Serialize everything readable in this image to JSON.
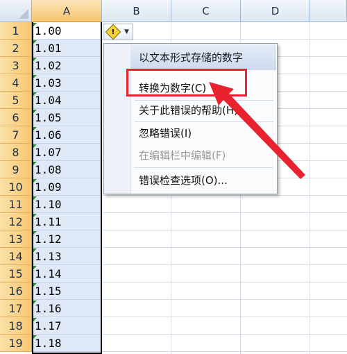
{
  "sheet": {
    "column_headers": [
      "A",
      "B",
      "C",
      "D"
    ],
    "row_numbers": [
      "1",
      "2",
      "3",
      "4",
      "5",
      "6",
      "7",
      "8",
      "9",
      "10",
      "11",
      "12",
      "13",
      "14",
      "15",
      "16",
      "17",
      "18",
      "19"
    ],
    "column_a_values": [
      "1.00",
      "1.01",
      "1.02",
      "1.03",
      "1.04",
      "1.05",
      "1.06",
      "1.07",
      "1.08",
      "1.09",
      "1.10",
      "1.11",
      "1.12",
      "1.13",
      "1.14",
      "1.15",
      "1.16",
      "1.17",
      "1.18"
    ]
  },
  "error_button": {
    "icon": "warning-diamond-icon",
    "symbol": "!",
    "dropdown_icon": "chevron-down-icon"
  },
  "context_menu": {
    "header": "以文本形式存储的数字",
    "items": [
      {
        "label": "转换为数字(C)",
        "enabled": true,
        "highlighted": true
      },
      {
        "label": "关于此错误的帮助(H)",
        "enabled": true
      },
      {
        "label": "忽略错误(I)",
        "enabled": true
      },
      {
        "label": "在编辑栏中编辑(F)",
        "enabled": false
      },
      {
        "label": "错误检查选项(O)...",
        "enabled": true
      }
    ]
  },
  "colors": {
    "selected_header": "#f6c66d",
    "annotation_red": "#e8222e",
    "error_indicator_green": "#2e8b3d"
  }
}
